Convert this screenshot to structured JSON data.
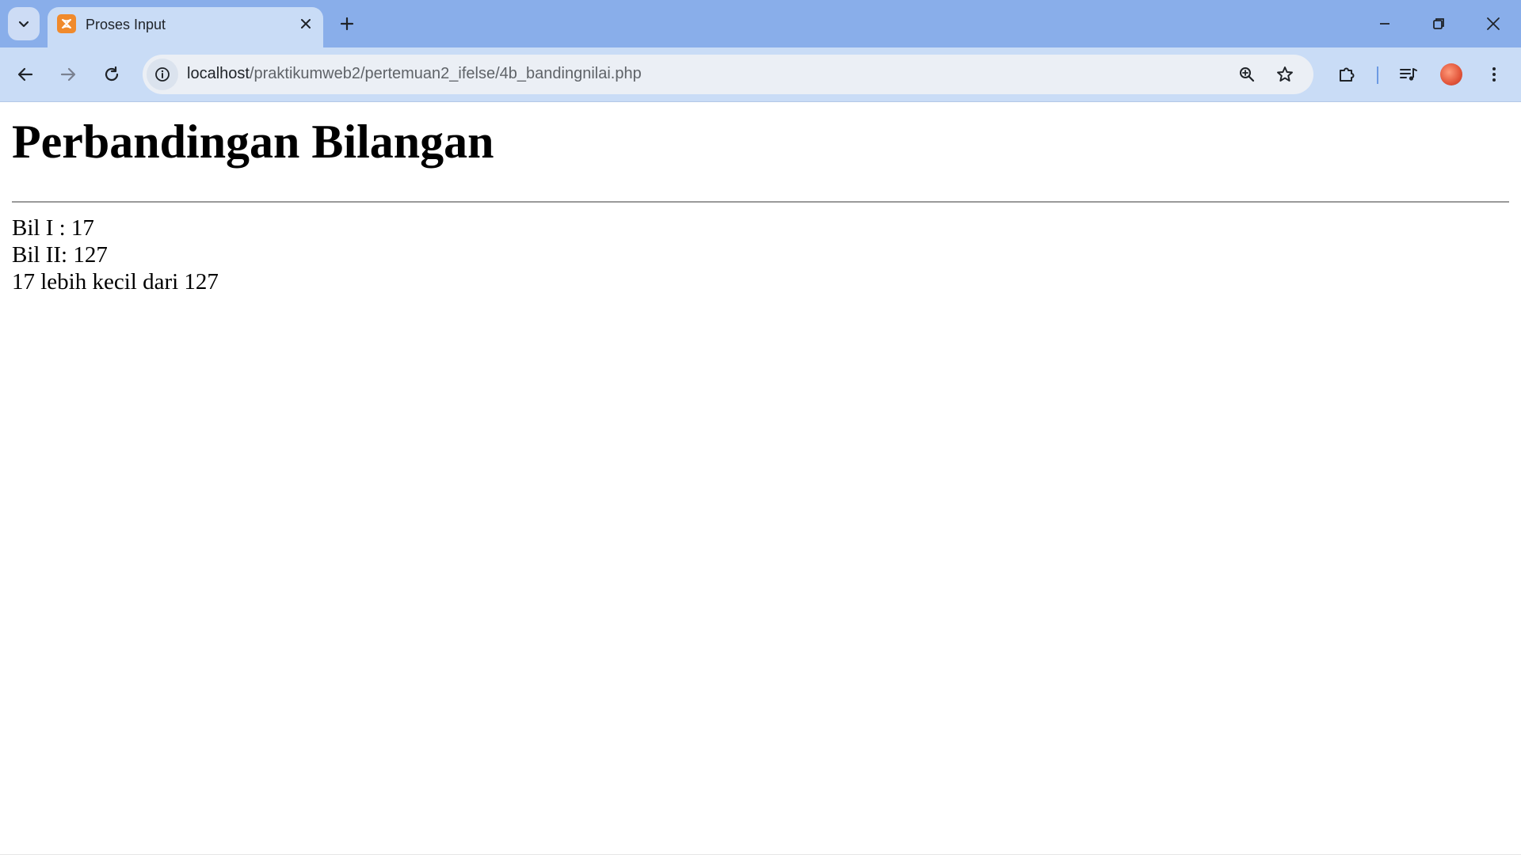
{
  "browser": {
    "tab": {
      "title": "Proses Input",
      "favicon": "xampp-icon"
    },
    "address_bar": {
      "host": "localhost",
      "path": "/praktikumweb2/pertemuan2_ifelse/4b_bandingnilai.php"
    },
    "icons": {
      "tab_search": "chevron-down-icon",
      "tab_close": "close-icon",
      "new_tab": "plus-icon",
      "minimize": "minimize-icon",
      "restore": "restore-icon",
      "close_window": "close-icon",
      "back": "arrow-left-icon",
      "forward": "arrow-right-icon",
      "reload": "reload-icon",
      "site_info": "info-icon",
      "zoom": "zoom-in-icon",
      "bookmark": "star-icon",
      "extensions": "puzzle-icon",
      "media": "media-queue-icon",
      "profile": "avatar",
      "menu": "kebab-menu-icon"
    },
    "colors": {
      "tabstrip": "#89aeea",
      "toolbar": "#c9dcf6",
      "favicon": "#f08a2c"
    }
  },
  "page": {
    "heading": "Perbandingan Bilangan",
    "lines": [
      "Bil I : 17",
      "Bil II: 127",
      "17 lebih kecil dari 127"
    ]
  }
}
